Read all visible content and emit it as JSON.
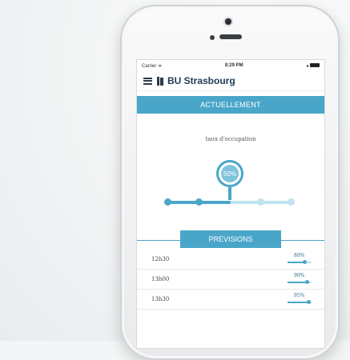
{
  "status_bar": {
    "carrier": "Carrier ᯤ",
    "time": "8:29 PM",
    "signal": "◂"
  },
  "header": {
    "title": "BU Strasbourg"
  },
  "current": {
    "banner": "ACTUELLEMENT",
    "occupancy_label": "taux d'occupation",
    "occupancy_value": "50%",
    "occupancy_fraction": 0.5
  },
  "forecast": {
    "banner": "PREVISIONS",
    "rows": [
      {
        "time": "12h30",
        "value": "80%",
        "fraction": 0.8
      },
      {
        "time": "13h00",
        "value": "90%",
        "fraction": 0.9
      },
      {
        "time": "13h30",
        "value": "95%",
        "fraction": 0.95
      }
    ]
  },
  "colors": {
    "accent": "#4aa6c9",
    "accent_light": "#bfe3ef",
    "title": "#1f3a56"
  },
  "icons": {
    "menu": "hamburger-menu-icon",
    "logo": "book-icon",
    "battery": "battery-icon"
  }
}
